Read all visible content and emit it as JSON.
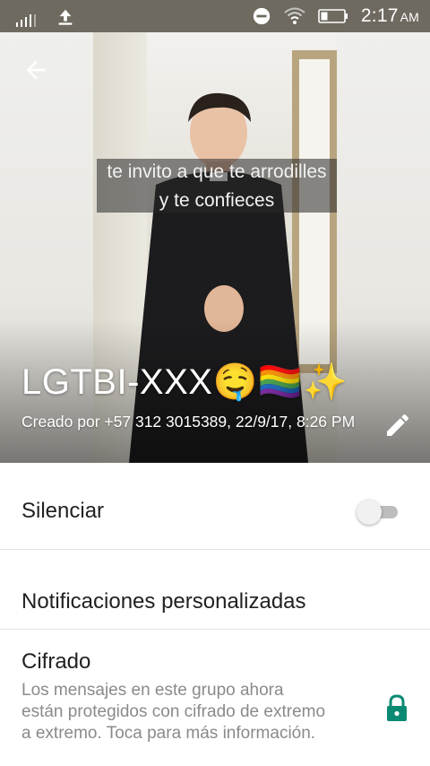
{
  "status_bar": {
    "time": "2:17",
    "ampm": "AM",
    "icons": [
      "signal-icon",
      "upload-icon",
      "do-not-disturb-icon",
      "wifi-icon",
      "battery-icon"
    ]
  },
  "header": {
    "image_caption_line1": "te invito a que te arrodilles",
    "image_caption_line2": "y te confieces",
    "group_name": "LGTBI-XXX🤤🏳️‍🌈✨",
    "created_by": "Creado por +57 312 3015389, 22/9/17, 8:26 PM",
    "back_icon": "arrow-back-icon",
    "edit_icon": "pencil-icon"
  },
  "settings": {
    "mute_label": "Silenciar",
    "mute_enabled": false,
    "custom_notifications_label": "Notificaciones personalizadas",
    "encryption_title": "Cifrado",
    "encryption_description": "Los mensajes en este grupo ahora están protegidos con cifrado de extremo a extremo. Toca para más información.",
    "lock_icon": "lock-icon"
  },
  "colors": {
    "accent": "#0b8a73",
    "status_bar": "#6e6a5f",
    "text_primary": "#212121",
    "text_secondary": "#8a8a8a"
  }
}
